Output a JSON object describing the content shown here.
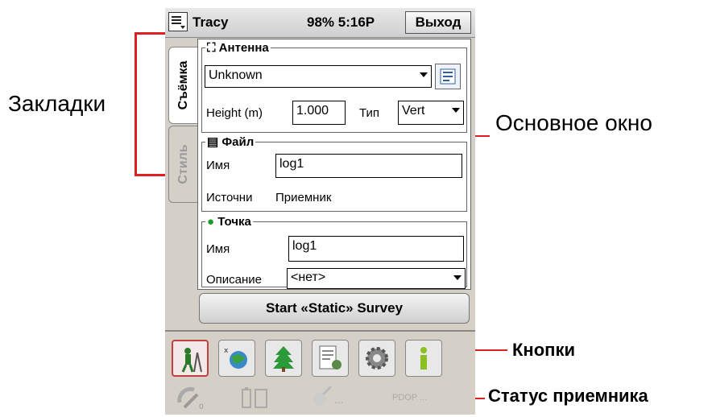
{
  "annotations": {
    "tabs": "Закладки",
    "main_window": "Основное окно",
    "buttons": "Кнопки",
    "receiver_status": "Статус приемника"
  },
  "titlebar": {
    "app_name": "Tracy",
    "status": "98% 5:16P",
    "exit_label": "Выход"
  },
  "tabs": [
    {
      "label": "Съёмка",
      "active": true
    },
    {
      "label": "Стиль",
      "active": false
    }
  ],
  "antenna": {
    "legend": "Антенна",
    "model": "Unknown",
    "height_label": "Height (m)",
    "height_value": "1.000",
    "type_label": "Тип",
    "type_value": "Vert"
  },
  "file": {
    "legend": "Файл",
    "name_label": "Имя",
    "name_value": "log1",
    "source_label": "Источни",
    "source_value": "Приемник"
  },
  "point": {
    "legend": "Точка",
    "name_label": "Имя",
    "name_value": "log1",
    "description_label": "Описание",
    "description_value": "<нет>"
  },
  "start_button": "Start «Static» Survey",
  "toolbar_buttons": [
    {
      "icon": "surveyor-icon",
      "active": true
    },
    {
      "icon": "cogo-icon",
      "active": false
    },
    {
      "icon": "tree-icon",
      "active": false
    },
    {
      "icon": "notebook-satellite-icon",
      "active": false
    },
    {
      "icon": "gear-icon",
      "active": false
    },
    {
      "icon": "info-icon",
      "active": false
    }
  ],
  "status_items": [
    {
      "icon": "satellite-count-icon",
      "text": ""
    },
    {
      "icon": "battery-icon",
      "text": ""
    },
    {
      "icon": "link-icon",
      "text": "..."
    },
    {
      "icon": "pdop-icon",
      "text": "PDOP ..."
    }
  ],
  "colors": {
    "annotation_line": "#e02020",
    "active_button_border": "#c04040"
  }
}
